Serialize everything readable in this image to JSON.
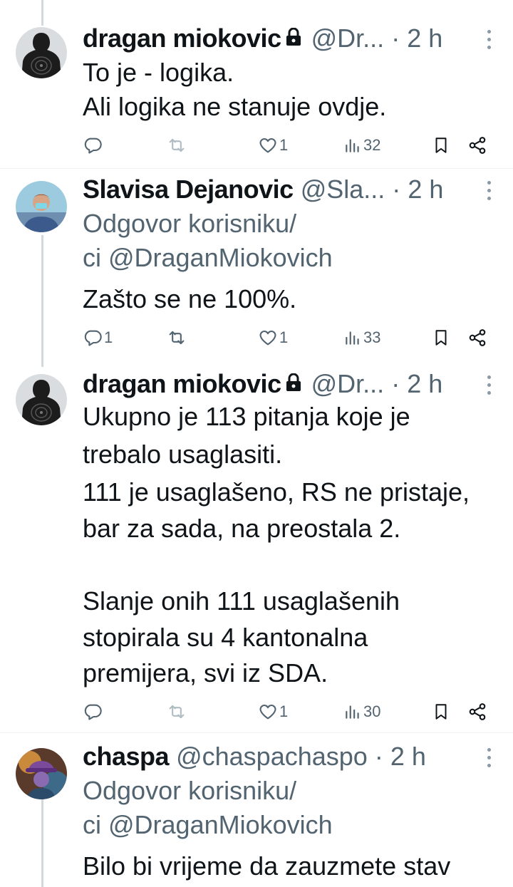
{
  "tweets": [
    {
      "name": "dragan miokovic",
      "handle": "@Dr...",
      "dot": "·",
      "time": "2 h",
      "locked": true,
      "lines": [
        "To je - logika.",
        "Ali logika ne stanuje ovdje."
      ],
      "actions": {
        "replies": "",
        "retweets": "",
        "likes": "1",
        "views": "32"
      }
    },
    {
      "name": "Slavisa Dejanovic",
      "handle": "@Sla...",
      "dot": "·",
      "time": "2 h",
      "locked": false,
      "reply_to": [
        "Odgovor korisniku/",
        "ci @DraganMiokovich"
      ],
      "lines": [
        "Zašto se ne 100%."
      ],
      "actions": {
        "replies": "1",
        "retweets": "",
        "likes": "1",
        "views": "33"
      }
    },
    {
      "name": "dragan miokovic",
      "handle": "@Dr...",
      "dot": "·",
      "time": "2 h",
      "locked": true,
      "lines": [
        "Ukupno je 113 pitanja koje je",
        "trebalo usaglasiti.",
        "111 je usaglašeno, RS ne pristaje,",
        "bar za sada, na preostala 2.",
        "",
        "Slanje onih 111 usaglašenih",
        "stopirala su 4 kantonalna",
        "premijera, svi iz SDA."
      ],
      "actions": {
        "replies": "",
        "retweets": "",
        "likes": "1",
        "views": "30"
      }
    },
    {
      "name": "chaspa",
      "handle": "@chaspachaspo",
      "dot": "·",
      "time": "2 h",
      "locked": false,
      "reply_to": [
        "Odgovor korisniku/",
        "ci @DraganMiokovich"
      ],
      "lines": [
        "Bilo bi vrijeme da zauzmete stav"
      ]
    }
  ],
  "icons": [
    "reply-icon",
    "retweet-icon",
    "like-icon",
    "views-icon",
    "bookmark-icon",
    "share-icon",
    "lock-icon",
    "more-icon"
  ],
  "colors": {
    "text": "#0f1419",
    "secondary": "#536471",
    "thread_line": "#cfd9de",
    "separator": "#eff3f4"
  }
}
